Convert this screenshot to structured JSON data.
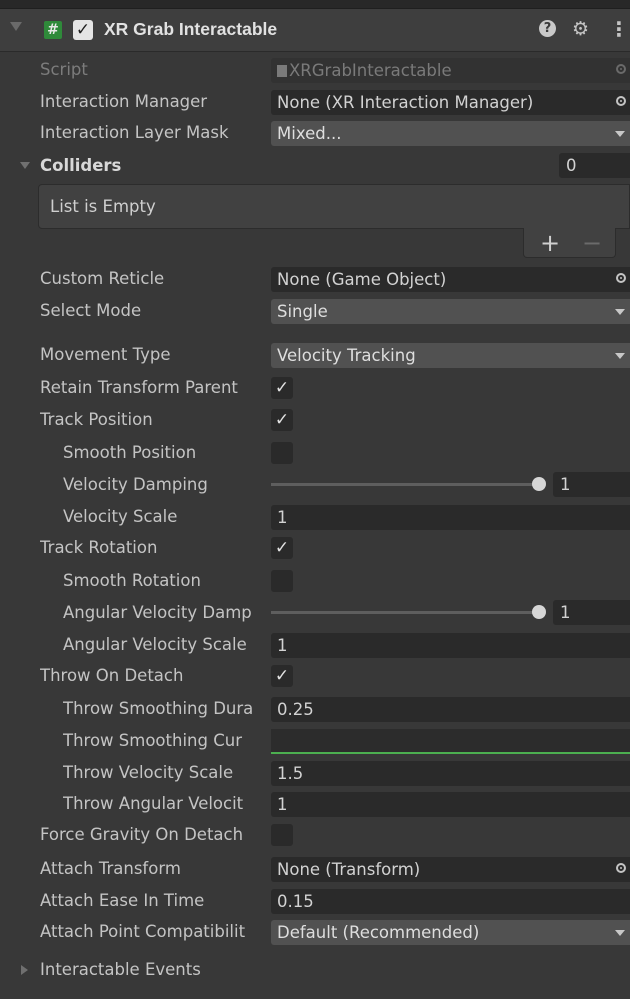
{
  "header": {
    "title": "XR Grab Interactable",
    "enabled_mark": "✓",
    "script_glyph": "#",
    "help_glyph": "?",
    "presets_glyph": "⚙",
    "menu_glyph": "⋮"
  },
  "fields": {
    "script": {
      "label": "Script",
      "value": "XRGrabInteractable"
    },
    "interaction_manager": {
      "label": "Interaction Manager",
      "value": "None (XR Interaction Manager)"
    },
    "interaction_layer_mask": {
      "label": "Interaction Layer Mask",
      "value": "Mixed..."
    },
    "custom_reticle": {
      "label": "Custom Reticle",
      "value": "None (Game Object)"
    },
    "select_mode": {
      "label": "Select Mode",
      "value": "Single"
    },
    "movement_type": {
      "label": "Movement Type",
      "value": "Velocity Tracking"
    },
    "retain_transform_parent": {
      "label": "Retain Transform Parent",
      "checked": true
    },
    "track_position": {
      "label": "Track Position",
      "checked": true
    },
    "smooth_position": {
      "label": "Smooth Position",
      "checked": false
    },
    "velocity_damping": {
      "label": "Velocity Damping",
      "value": "1",
      "slider_fraction": 1.0
    },
    "velocity_scale": {
      "label": "Velocity Scale",
      "value": "1"
    },
    "track_rotation": {
      "label": "Track Rotation",
      "checked": true
    },
    "smooth_rotation": {
      "label": "Smooth Rotation",
      "checked": false
    },
    "angular_velocity_damping": {
      "label": "Angular Velocity Damp",
      "value": "1",
      "slider_fraction": 1.0
    },
    "angular_velocity_scale": {
      "label": "Angular Velocity Scale",
      "value": "1"
    },
    "throw_on_detach": {
      "label": "Throw On Detach",
      "checked": true
    },
    "throw_smoothing_duration": {
      "label": "Throw Smoothing Dura",
      "value": "0.25"
    },
    "throw_smoothing_curve": {
      "label": "Throw Smoothing Cur",
      "curve_color": "#4caf50"
    },
    "throw_velocity_scale": {
      "label": "Throw Velocity Scale",
      "value": "1.5"
    },
    "throw_angular_velocity": {
      "label": "Throw Angular Velocit",
      "value": "1"
    },
    "force_gravity_on_detach": {
      "label": "Force Gravity On Detach",
      "checked": false
    },
    "attach_transform": {
      "label": "Attach Transform",
      "value": "None (Transform)"
    },
    "attach_ease_in_time": {
      "label": "Attach Ease In Time",
      "value": "0.15"
    },
    "attach_point_compatibility": {
      "label": "Attach Point Compatibilit",
      "value": "Default (Recommended)"
    }
  },
  "colliders": {
    "label": "Colliders",
    "count": "0",
    "empty_text": "List is Empty",
    "add_label": "+",
    "remove_label": "−"
  },
  "events": {
    "label": "Interactable Events"
  },
  "check_mark": "✓",
  "colors": {
    "background": "#383838",
    "field": "#2a2a2a",
    "accent_green": "#4caf50"
  }
}
